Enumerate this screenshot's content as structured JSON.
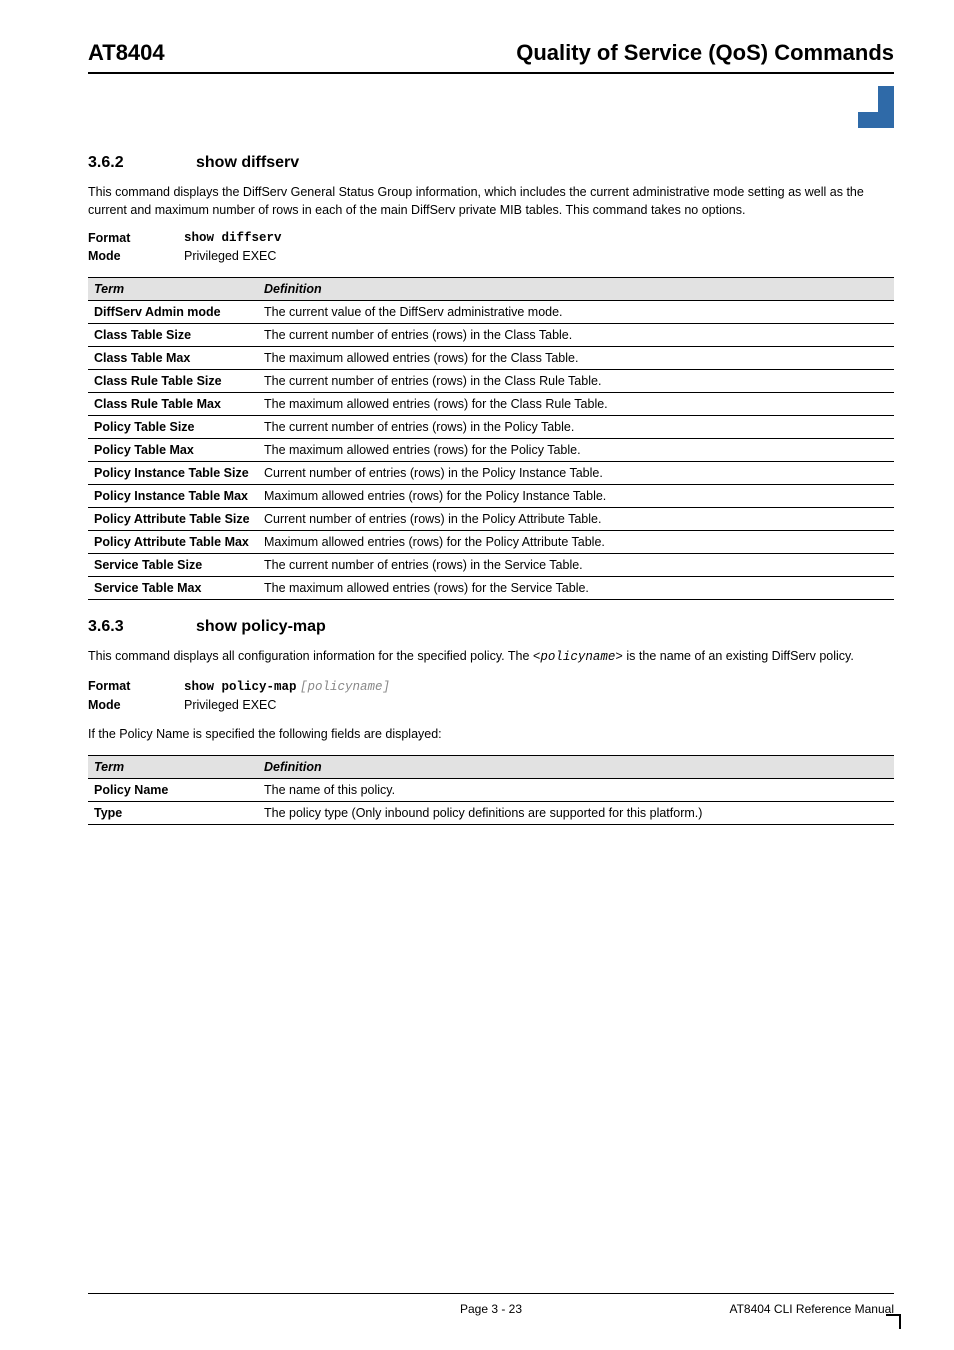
{
  "header": {
    "left": "AT8404",
    "right": "Quality of Service (QoS) Commands"
  },
  "section1": {
    "number": "3.6.2",
    "title": "show diffserv",
    "intro": "This command displays the DiffServ General Status Group information, which includes the current administrative mode setting as well as the current and maximum number of rows in each of the main DiffServ private MIB tables. This command takes no options.",
    "format_label": "Format",
    "format_value": "show diffserv",
    "mode_label": "Mode",
    "mode_value": "Privileged EXEC",
    "table": {
      "head_term": "Term",
      "head_def": "Definition",
      "rows": [
        {
          "term": "DiffServ Admin mode",
          "def": "The current value of the DiffServ administrative mode."
        },
        {
          "term": "Class Table Size",
          "def": "The current number of entries (rows) in the Class Table."
        },
        {
          "term": "Class Table Max",
          "def": "The maximum allowed entries (rows) for the Class Table."
        },
        {
          "term": "Class Rule Table Size",
          "def": "The current number of entries (rows) in the Class Rule Table."
        },
        {
          "term": "Class Rule Table Max",
          "def": "The maximum allowed entries (rows) for the Class Rule Table."
        },
        {
          "term": "Policy Table Size",
          "def": "The current number of entries (rows) in the Policy Table."
        },
        {
          "term": "Policy Table Max",
          "def": "The maximum allowed entries (rows) for the Policy Table."
        },
        {
          "term": "Policy Instance Table Size",
          "def": "Current number of entries (rows) in the Policy Instance Table."
        },
        {
          "term": "Policy Instance Table Max",
          "def": "Maximum allowed entries (rows) for the Policy Instance Table."
        },
        {
          "term": "Policy Attribute Table Size",
          "def": "Current number of entries (rows) in the Policy Attribute Table."
        },
        {
          "term": "Policy Attribute Table Max",
          "def": "Maximum allowed entries (rows) for the Policy Attribute Table."
        },
        {
          "term": "Service Table Size",
          "def": "The current number of entries (rows) in the Service Table."
        },
        {
          "term": "Service Table Max",
          "def": "The maximum allowed entries (rows) for the Service Table."
        }
      ]
    }
  },
  "section2": {
    "number": "3.6.3",
    "title": "show policy-map",
    "intro_pre": "This command displays all configuration information for the specified policy. The ",
    "intro_code": "<policyname>",
    "intro_post": " is the name of an existing DiffServ policy.",
    "format_label": "Format",
    "format_cmd": "show policy-map",
    "format_arg": "[policyname]",
    "mode_label": "Mode",
    "mode_value": "Privileged EXEC",
    "note": "If the Policy Name is specified the following fields are displayed:",
    "table": {
      "head_term": "Term",
      "head_def": "Definition",
      "rows": [
        {
          "term": "Policy Name",
          "def": "The name of this policy."
        },
        {
          "term": "Type",
          "def": "The policy type (Only inbound policy definitions are supported for this platform.)"
        }
      ]
    }
  },
  "footer": {
    "center": "Page 3 - 23",
    "right": "AT8404 CLI Reference Manual"
  }
}
